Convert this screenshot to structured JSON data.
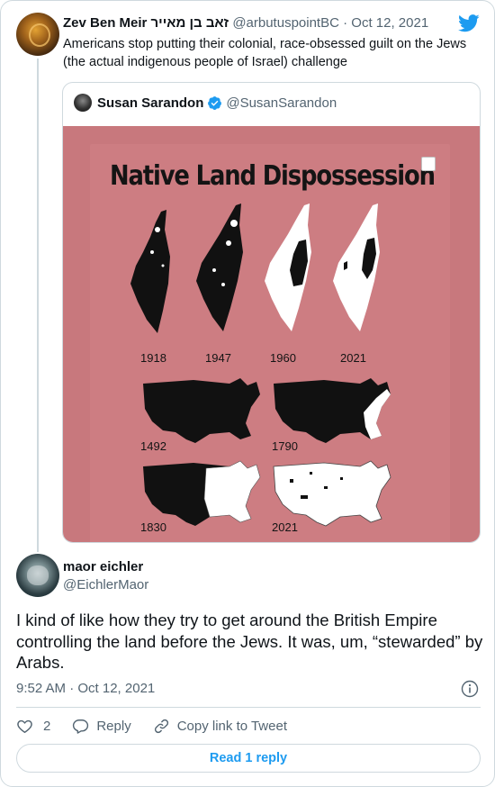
{
  "tweet1": {
    "name": "Zev Ben Meir זאב בן מאייר",
    "handle": "@arbutuspointBC",
    "separator": "·",
    "date": "Oct 12, 2021",
    "text": "Americans stop putting their colonial, race-obsessed guilt on the Jews (the actual indigenous people of Israel) challenge"
  },
  "quoted_tweet": {
    "name": "Susan Sarandon",
    "handle": "@SusanSarandon",
    "media": {
      "title": "Native Land Dispossession",
      "years_israel": [
        "1918",
        "1947",
        "1960",
        "2021"
      ],
      "years_usa": [
        "1492",
        "1790",
        "1830",
        "2021"
      ],
      "background_color": "#cd7d82"
    }
  },
  "tweet2": {
    "name": "maor eichler",
    "handle": "@EichlerMaor",
    "text": "I kind of like how they try to get around the British Empire controlling the land before the Jews. It was, um, “stewarded” by Arabs.",
    "timestamp": "9:52 AM · Oct 12, 2021"
  },
  "actions": {
    "like_count": "2",
    "reply_label": "Reply",
    "copy_link_label": "Copy link to Tweet"
  },
  "read_reply_label": "Read 1 reply",
  "colors": {
    "accent": "#1d9bf0",
    "secondary_text": "#536471",
    "border": "#cfd9de"
  }
}
